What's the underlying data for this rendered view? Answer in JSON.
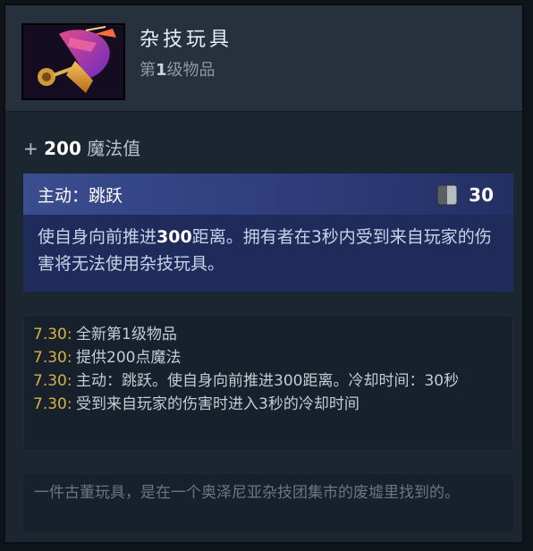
{
  "item": {
    "title": "杂技玩具",
    "tier_prefix": "第",
    "tier_number": "1",
    "tier_suffix": "级物品",
    "icon": "acrobatic-toy-icon"
  },
  "stat": {
    "sign": "+",
    "value": "200",
    "label": "魔法值"
  },
  "active": {
    "label": "主动：跳跃",
    "cooldown": "30",
    "cooldown_icon": "cooldown-icon",
    "desc_part1": "使自身向前推进",
    "desc_number": "300",
    "desc_part2": "距离。拥有者在3秒内受到来自玩家的伤害将无法使用杂技玩具。"
  },
  "notes": [
    {
      "version": "7.30:",
      "text": "全新第1级物品"
    },
    {
      "version": "7.30:",
      "text": "提供200点魔法"
    },
    {
      "version": "7.30:",
      "text": "主动：跳跃。使自身向前推进300距离。冷却时间：30秒"
    },
    {
      "version": "7.30:",
      "text": "受到来自玩家的伤害时进入3秒的冷却时间"
    }
  ],
  "lore": "一件古董玩具，是在一个奥泽尼亚杂技团集市的废墟里找到的。",
  "colors": {
    "accent_version": "#d4b24a",
    "active_header": "#3a4d8f",
    "panel_bg": "#1c2631"
  }
}
